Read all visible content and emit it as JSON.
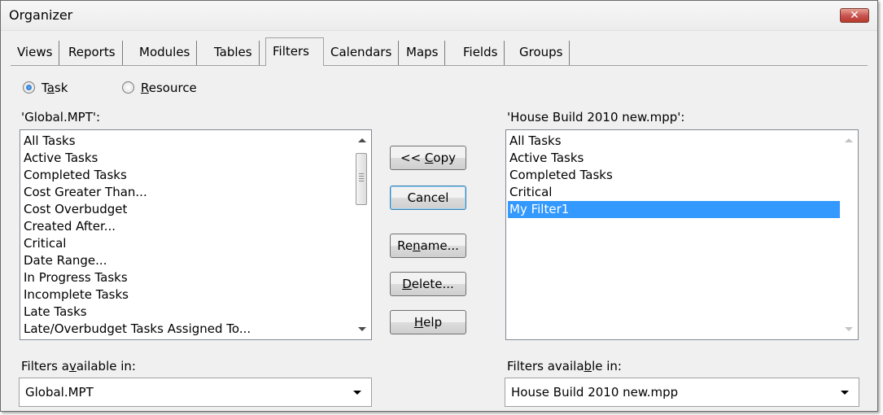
{
  "window": {
    "title": "Organizer",
    "close_glyph": "✕"
  },
  "tabs": [
    "Views",
    "Reports",
    "Modules",
    "Tables",
    "Filters",
    "Calendars",
    "Maps",
    "Fields",
    "Groups"
  ],
  "active_tab": "Filters",
  "radio": {
    "task": {
      "pre": "T",
      "key": "a",
      "post": "sk",
      "checked": true
    },
    "resource": {
      "pre": "",
      "key": "R",
      "post": "esource",
      "checked": false
    }
  },
  "left_list": {
    "label": "'Global.MPT':",
    "items": [
      "All Tasks",
      "Active Tasks",
      "Completed Tasks",
      "Cost Greater Than...",
      "Cost Overbudget",
      "Created After...",
      "Critical",
      "Date Range...",
      "In Progress Tasks",
      "Incomplete Tasks",
      "Late Tasks",
      "Late/Overbudget Tasks Assigned To..."
    ]
  },
  "right_list": {
    "label": "'House Build 2010 new.mpp':",
    "items": [
      "All Tasks",
      "Active Tasks",
      "Completed Tasks",
      "Critical",
      "My Filter1"
    ],
    "selected": "My Filter1"
  },
  "buttons": {
    "copy": {
      "pre": "<< ",
      "key": "C",
      "post": "opy"
    },
    "cancel": {
      "pre": "Cancel",
      "key": "",
      "post": ""
    },
    "rename": {
      "pre": "Re",
      "key": "n",
      "post": "ame..."
    },
    "delete": {
      "pre": "",
      "key": "D",
      "post": "elete..."
    },
    "help": {
      "pre": "",
      "key": "H",
      "post": "elp"
    }
  },
  "left_available": {
    "pre": "Filters a",
    "key": "v",
    "post": "ailable in:",
    "value": "Global.MPT"
  },
  "right_available": {
    "pre": "Filters availa",
    "key": "b",
    "post": "le in:",
    "value": "House Build 2010 new.mpp"
  }
}
